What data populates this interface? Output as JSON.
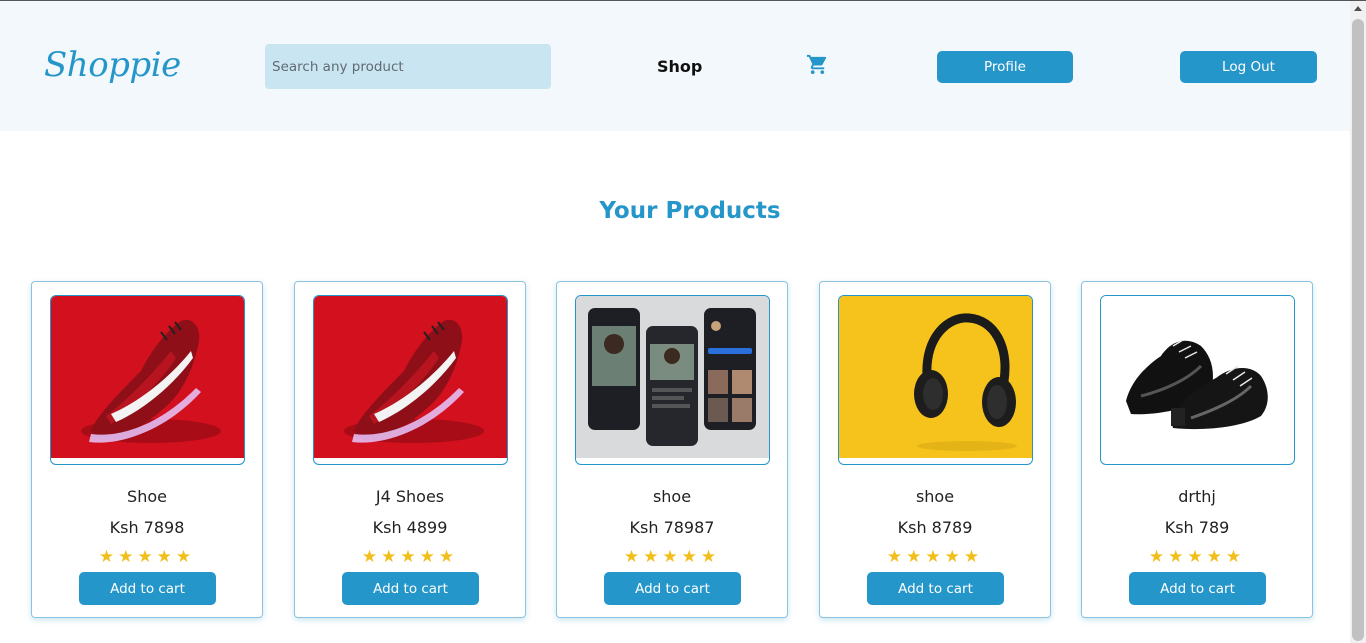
{
  "header": {
    "logo": "Shoppie",
    "search_placeholder": "Search any product",
    "nav_shop": "Shop",
    "cart_icon": "shopping-cart-icon",
    "profile_label": "Profile",
    "logout_label": "Log Out"
  },
  "main": {
    "title": "Your Products",
    "products": [
      {
        "name": "Shoe",
        "price": "Ksh 7898",
        "rating": 5,
        "stars": "★★★★★",
        "button": "Add to cart",
        "image": "red-sneaker"
      },
      {
        "name": "J4 Shoes",
        "price": "Ksh 4899",
        "rating": 5,
        "stars": "★★★★★",
        "button": "Add to cart",
        "image": "red-sneaker"
      },
      {
        "name": "shoe",
        "price": "Ksh 78987",
        "rating": 5,
        "stars": "★★★★★",
        "button": "Add to cart",
        "image": "app-screens"
      },
      {
        "name": "shoe",
        "price": "Ksh 8789",
        "rating": 5,
        "stars": "★★★★★",
        "button": "Add to cart",
        "image": "headphones"
      },
      {
        "name": "drthj",
        "price": "Ksh 789",
        "rating": 5,
        "stars": "★★★★★",
        "button": "Add to cart",
        "image": "black-dress-shoes"
      }
    ]
  },
  "colors": {
    "accent": "#2596c9",
    "header_bg": "#f2f8fb",
    "search_bg": "#cae5f2",
    "star": "#f2be1a"
  }
}
